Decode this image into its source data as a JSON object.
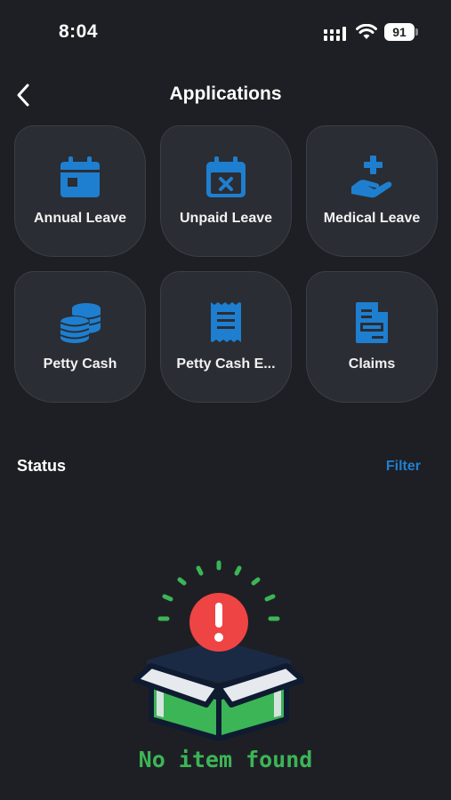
{
  "status_bar": {
    "time": "8:04",
    "battery": "91"
  },
  "header": {
    "title": "Applications"
  },
  "tiles": [
    {
      "label": "Annual Leave",
      "icon": "calendar-icon"
    },
    {
      "label": "Unpaid Leave",
      "icon": "calendar-x-icon"
    },
    {
      "label": "Medical Leave",
      "icon": "medical-hand-icon"
    },
    {
      "label": "Petty Cash",
      "icon": "coins-icon"
    },
    {
      "label": "Petty Cash E...",
      "icon": "receipt-icon"
    },
    {
      "label": "Claims",
      "icon": "document-icon"
    }
  ],
  "status_section": {
    "title": "Status",
    "filter_label": "Filter"
  },
  "empty_state": {
    "message": "No item found"
  },
  "colors": {
    "background": "#1e1f24",
    "tile": "#2a2d34",
    "accent": "#1e7fd0",
    "success_green": "#3cb556",
    "alert_red": "#ef4444"
  }
}
